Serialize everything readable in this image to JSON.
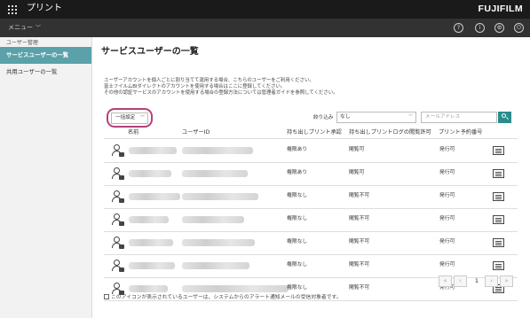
{
  "app": {
    "title": "プリント",
    "brand": "FUJIFILM"
  },
  "menubar": {
    "label": "メニュー",
    "icons": [
      "help-icon",
      "info-icon",
      "gear-icon",
      "power-icon"
    ]
  },
  "sidebar": {
    "section_label": "ユーザー管理",
    "items": [
      {
        "label": "サービスユーザーの一覧",
        "active": true
      },
      {
        "label": "共用ユーザーの一覧",
        "active": false
      }
    ]
  },
  "main": {
    "title": "サービスユーザーの一覧",
    "description": [
      "ユーザーアカウントを個人ごとに割り当てて運用する場合、こちらのユーザーをご利用ください。",
      "富士フイルムBIダイレクトのアカウントを使用する場合はここに登録してください。",
      "その他の認証サービスのアカウントを使用する場合の登録方法については管理者ガイドを参照してください。"
    ],
    "bulk_button": "一括設定",
    "filter": {
      "label": "絞り込み",
      "selected": "なし",
      "search_placeholder": "メールアドレス"
    },
    "columns": [
      "名前",
      "ユーザーID",
      "持ち出しプリント承認",
      "持ち出しプリントログの閲覧許可",
      "プリント予約番号"
    ],
    "rows": [
      {
        "approval": "権限あり",
        "log": "閲覧可",
        "reservation": "発行可"
      },
      {
        "approval": "権限あり",
        "log": "閲覧可",
        "reservation": "発行可"
      },
      {
        "approval": "権限なし",
        "log": "閲覧不可",
        "reservation": "発行可"
      },
      {
        "approval": "権限なし",
        "log": "閲覧不可",
        "reservation": "発行可"
      },
      {
        "approval": "権限なし",
        "log": "閲覧不可",
        "reservation": "発行可"
      },
      {
        "approval": "権限なし",
        "log": "閲覧不可",
        "reservation": "発行可"
      },
      {
        "approval": "権限なし",
        "log": "閲覧不可",
        "reservation": "発行可"
      }
    ],
    "pagination": {
      "current": "1"
    },
    "footnote": "このアイコンが表示されているユーザーは、システムからのアラート通知メールの受信対象者です。"
  },
  "colors": {
    "topbar": "#1a1a1a",
    "menubar": "#323232",
    "sidebar_active": "#5aa1a9",
    "search_button": "#2b8c8c",
    "highlight": "#b5417a"
  }
}
